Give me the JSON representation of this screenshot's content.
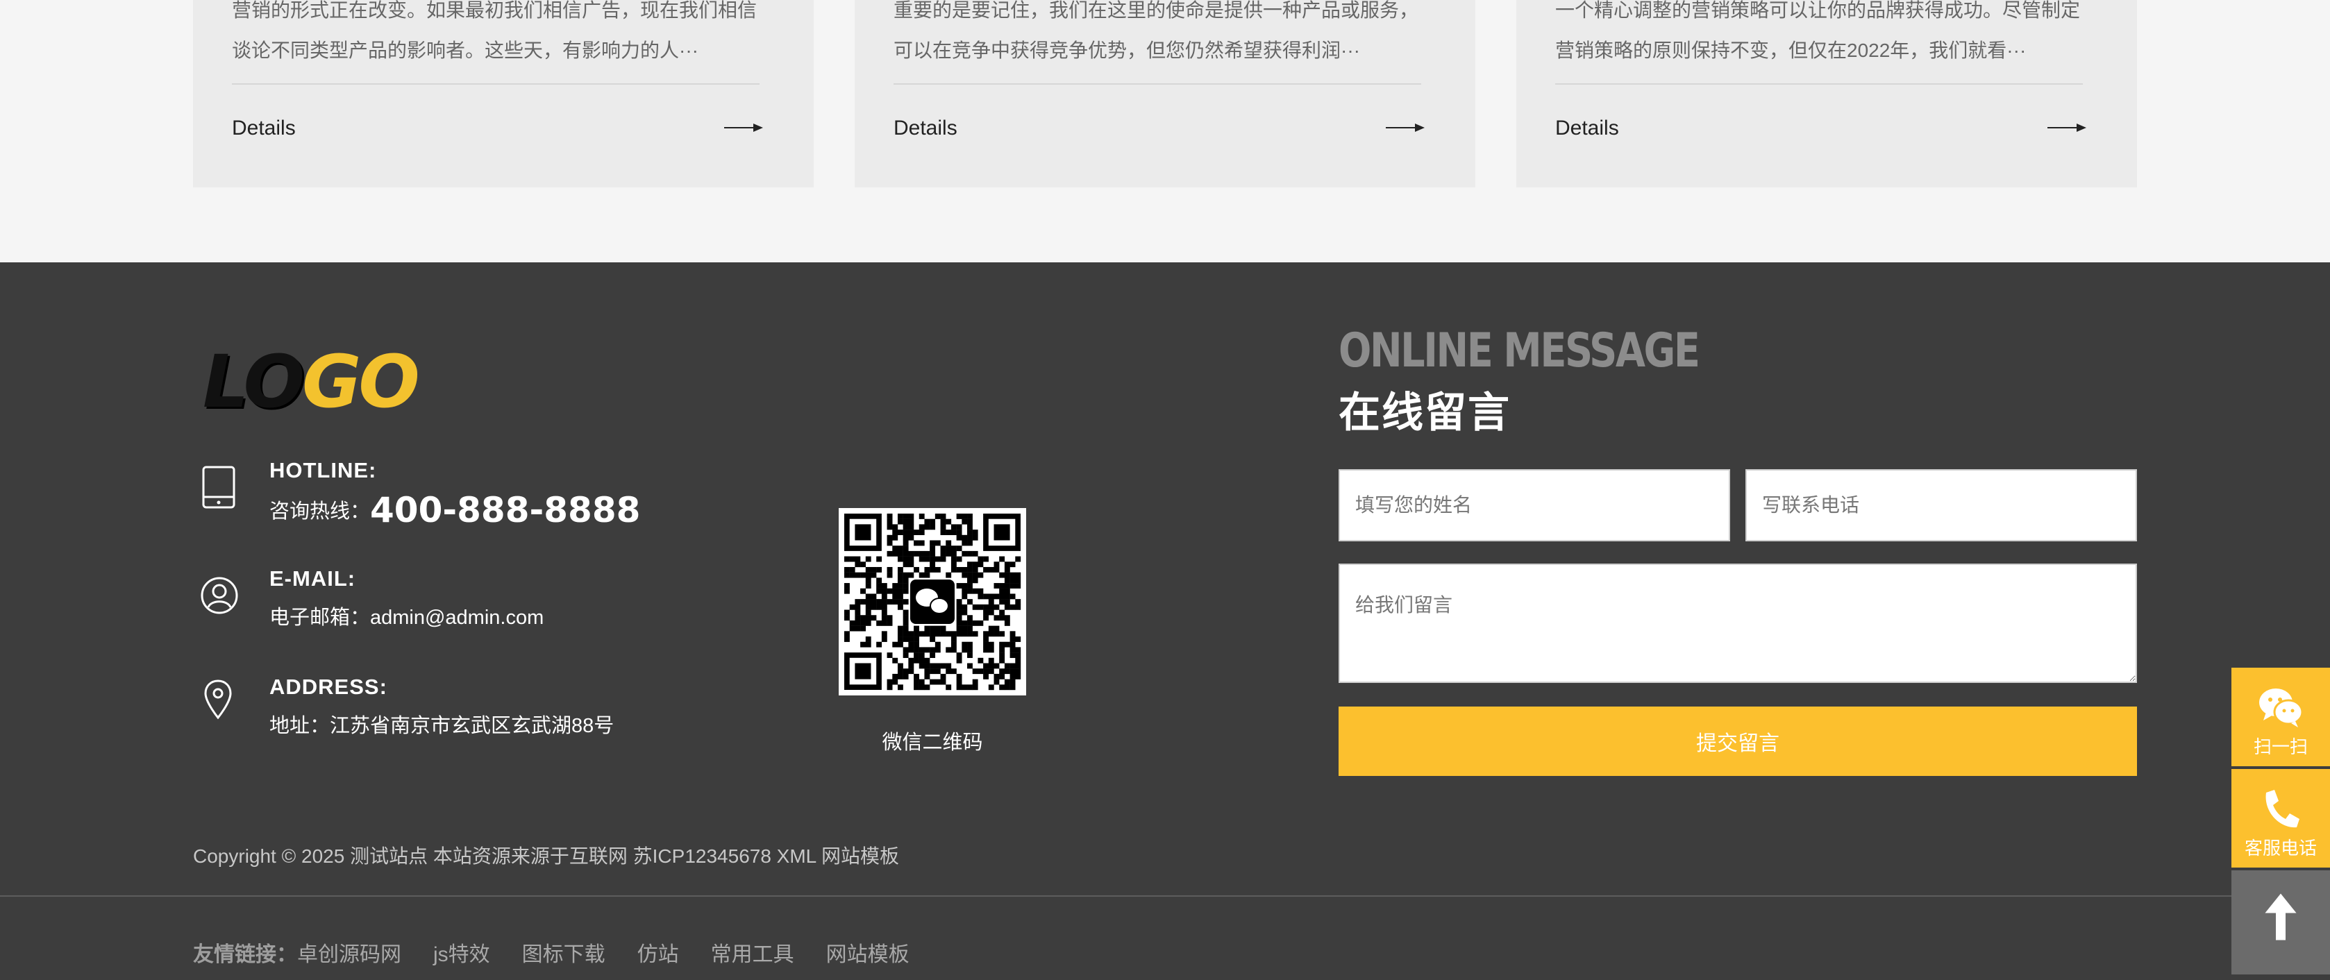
{
  "cards": [
    {
      "excerpt_line1": "营销的形式正在改变。如果最初我们相信广告，现在我们相信",
      "excerpt_line2": "谈论不同类型产品的影响者。这些天，有影响力的人···",
      "details_label": "Details"
    },
    {
      "excerpt_line1": "重要的是要记住，我们在这里的使命是提供一种产品或服务，",
      "excerpt_line2": "可以在竞争中获得竞争优势，但您仍然希望获得利润···",
      "details_label": "Details"
    },
    {
      "excerpt_line1": "一个精心调整的营销策略可以让你的品牌获得成功。尽管制定",
      "excerpt_line2": "营销策略的原则保持不变，但仅在2022年，我们就看···",
      "details_label": "Details"
    }
  ],
  "footer": {
    "logo": {
      "part1": "LO",
      "part2": "GO"
    },
    "hotline": {
      "label": "HOTLINE:",
      "prefix": "咨询热线：",
      "number": "400-888-8888"
    },
    "email": {
      "label": "E-MAIL:",
      "value": "电子邮箱：admin@admin.com"
    },
    "address": {
      "label": "ADDRESS:",
      "value": "地址：江苏省南京市玄武区玄武湖88号"
    },
    "qr_caption": "微信二维码",
    "message": {
      "title_en": "ONLINE MESSAGE",
      "title_cn": "在线留言",
      "name_placeholder": "填写您的姓名",
      "phone_placeholder": "写联系电话",
      "message_placeholder": "给我们留言",
      "submit_label": "提交留言"
    },
    "copyright": "Copyright © 2025 测试站点 本站资源来源于互联网 苏ICP12345678 XML 网站模板",
    "friend_links": {
      "label": "友情链接：",
      "items": [
        "卓创源码网",
        "js特效",
        "图标下载",
        "仿站",
        "常用工具",
        "网站模板"
      ]
    }
  },
  "float_bar": {
    "scan_label": "扫一扫",
    "phone_label": "客服电话"
  },
  "colors": {
    "accent": "#fcc02e",
    "footer_bg": "#3d3d3d",
    "card_bg": "#ebebeb",
    "page_bg": "#f5f5f5"
  },
  "icons": {
    "hotline": "tablet-icon",
    "email": "user-circle-icon",
    "address": "location-pin-icon",
    "card_action": "arrow-right-icon",
    "scan": "wechat-icon",
    "phone": "phone-icon",
    "top": "arrow-up-icon"
  }
}
